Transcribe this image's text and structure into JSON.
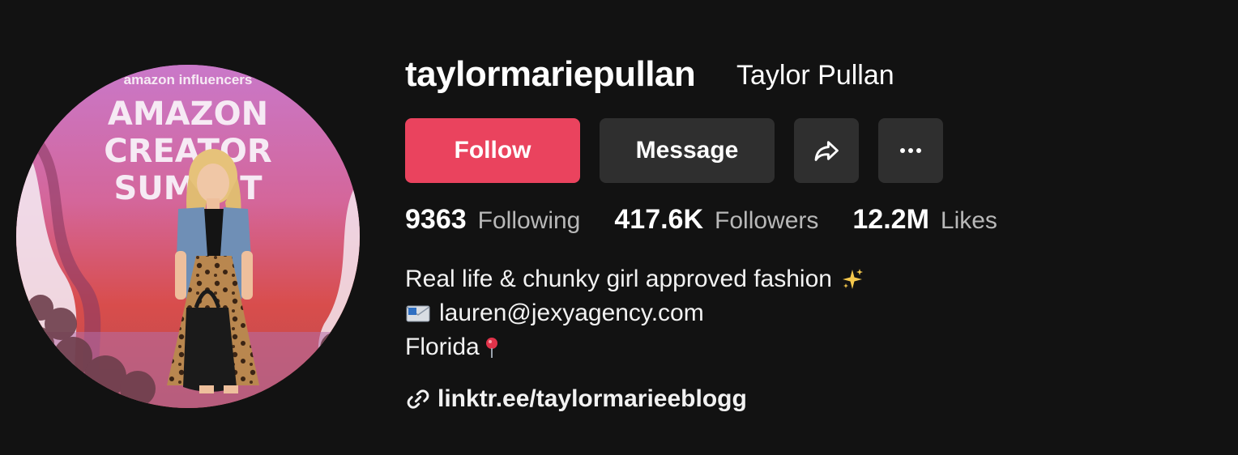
{
  "profile": {
    "username": "taylormariepullan",
    "display_name": "Taylor Pullan",
    "avatar_signage": {
      "brand": "amazon influencers",
      "line1": "AMAZON",
      "line2": "CREATOR",
      "line3": "SUMMIT"
    }
  },
  "actions": {
    "follow_label": "Follow",
    "message_label": "Message",
    "share_icon": "share-arrow-icon",
    "more_icon": "more-dots-icon"
  },
  "stats": {
    "following_count": "9363",
    "following_label": "Following",
    "followers_count": "417.6K",
    "followers_label": "Followers",
    "likes_count": "12.2M",
    "likes_label": "Likes"
  },
  "bio": {
    "line1": "Real life & chunky girl approved fashion",
    "line2": "lauren@jexyagency.com",
    "line3": "Florida"
  },
  "link": {
    "text": "linktr.ee/taylormarieeblogg",
    "icon": "link-icon"
  },
  "colors": {
    "background": "#121212",
    "follow": "#ea435e",
    "secondary_button": "#2f2f2f",
    "muted_text": "#b8b8b8"
  }
}
